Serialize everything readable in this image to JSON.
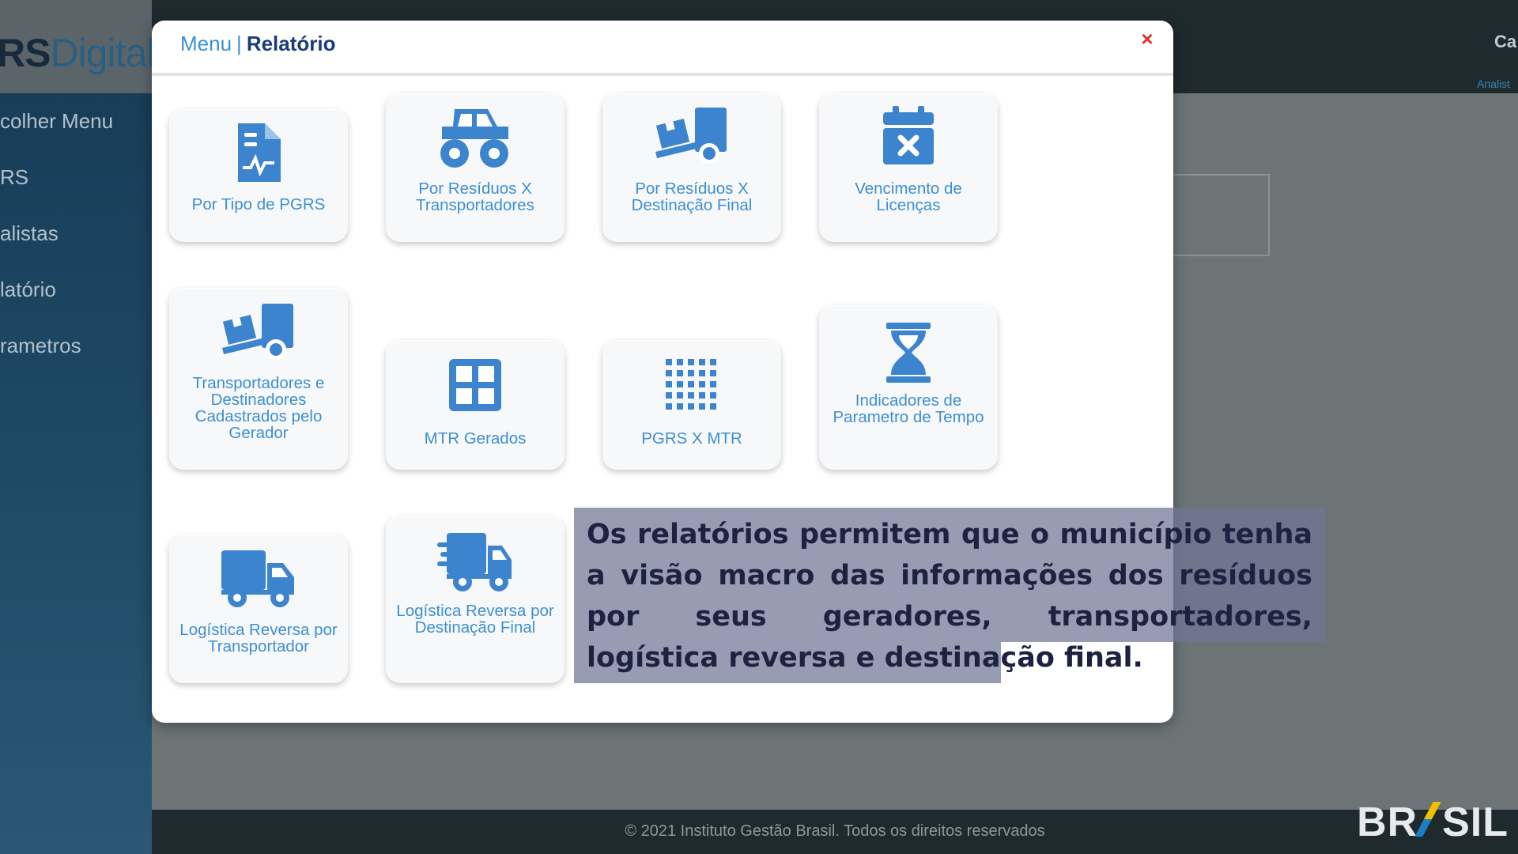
{
  "app": {
    "logo_bold": "RS",
    "logo_light": "Digital"
  },
  "sidebar": {
    "items": [
      {
        "label": "colher Menu"
      },
      {
        "label": "RS"
      },
      {
        "label": "alistas"
      },
      {
        "label": "latório"
      },
      {
        "label": "rametros"
      }
    ]
  },
  "topbar": {
    "right_text": "Ca",
    "right_subtext": "Analist"
  },
  "modal": {
    "breadcrumb_menu": "Menu",
    "breadcrumb_sep": "|",
    "breadcrumb_current": "Relatório",
    "close_label": "×",
    "tiles": [
      {
        "label": "Por Tipo de PGRS",
        "icon": "document-chart-icon"
      },
      {
        "label": "Por Resíduos X Transportadores",
        "icon": "monster-truck-icon"
      },
      {
        "label": "Por Resíduos X Destinação Final",
        "icon": "dolly-boxes-icon"
      },
      {
        "label": "Vencimento de Licenças",
        "icon": "calendar-times-icon"
      },
      {
        "label": "Transportadores e Destinadores Cadastrados pelo Gerador",
        "icon": "dolly-boxes-icon"
      },
      {
        "label": "MTR Gerados",
        "icon": "grid-icon"
      },
      {
        "label": "PGRS X MTR",
        "icon": "dots-grid-icon"
      },
      {
        "label": "Indicadores de Parametro de Tempo",
        "icon": "hourglass-icon"
      },
      {
        "label": "Logística Reversa por Transportador",
        "icon": "truck-icon"
      },
      {
        "label": "Logística Reversa por Destinação Final",
        "icon": "fast-truck-icon"
      }
    ]
  },
  "caption": {
    "text": "Os relatórios permitem que o município tenha a visão macro das informações dos resíduos por seus geradores, transportadores, logística reversa e destinação final."
  },
  "footer": {
    "text": "© 2021 Instituto Gestão Brasil. Todos os direitos reservados"
  },
  "brand": {
    "watermark_text": "BRASIL"
  },
  "colors": {
    "accent": "#3b8fd6",
    "icon_blue": "#3d84cf",
    "close_red": "#e0302a",
    "sidebar_bg": "#1a4160"
  }
}
